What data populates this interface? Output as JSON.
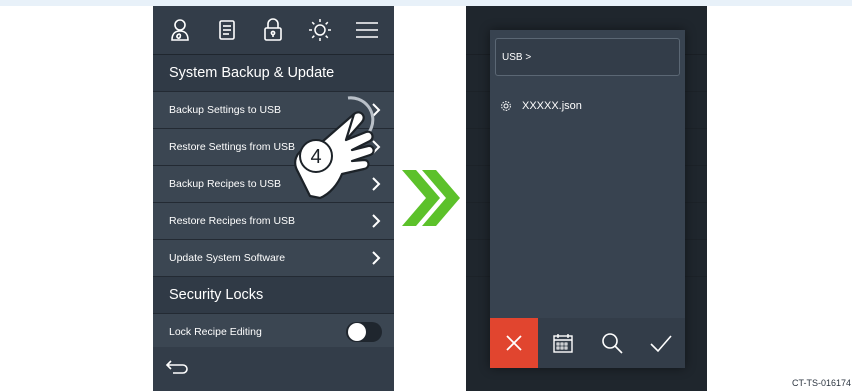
{
  "left_screen": {
    "section_backup": "System Backup & Update",
    "menu": [
      {
        "label": "Backup Settings to USB"
      },
      {
        "label": "Restore Settings from USB"
      },
      {
        "label": "Backup Recipes to USB"
      },
      {
        "label": "Restore Recipes from USB"
      },
      {
        "label": "Update System Software"
      }
    ],
    "section_security": "Security Locks",
    "lock_recipe_label": "Lock Recipe Editing",
    "lock_recipe_state": "off",
    "step_number": "4",
    "icons": [
      "user-icon",
      "document-icon",
      "lock-icon",
      "brightness-icon",
      "menu-icon",
      "back-icon"
    ]
  },
  "right_screen": {
    "path": "USB >",
    "files": [
      {
        "name": "XXXXX.json",
        "icon": "gear-icon"
      }
    ],
    "actions": [
      "cancel-icon",
      "calendar-icon",
      "search-icon",
      "check-icon"
    ]
  },
  "caption": "CT-TS-016174",
  "colors": {
    "panel": "#2c3540",
    "row": "#3b4652",
    "arrow": "#5cc12a",
    "cancel": "#e1452f"
  }
}
